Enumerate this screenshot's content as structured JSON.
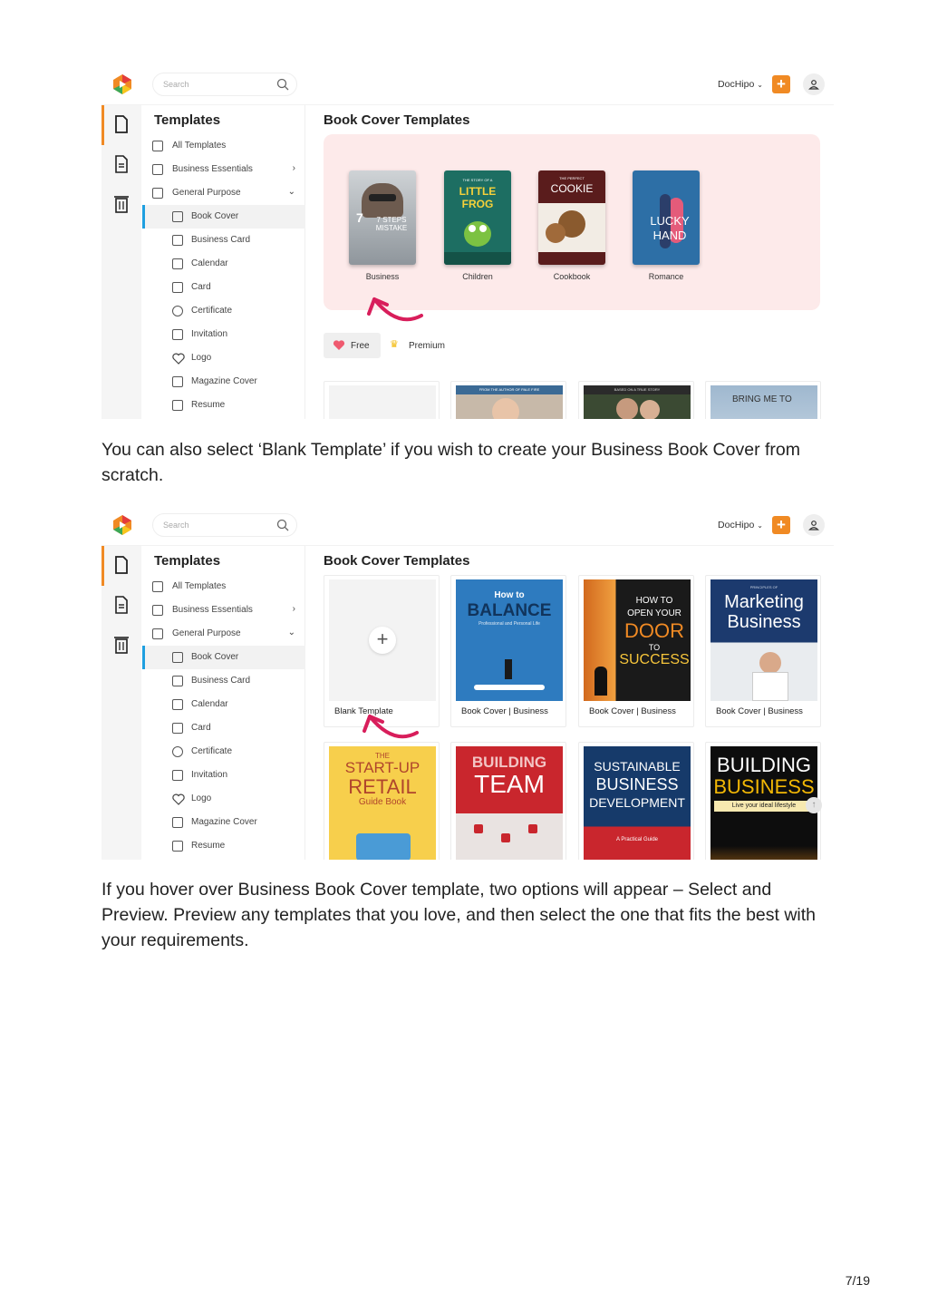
{
  "app": {
    "account": "DocHipo",
    "search_placeholder": "Search"
  },
  "sidebar": {
    "title": "Templates",
    "items": [
      {
        "label": "All Templates",
        "icon": "all-templates-icon"
      },
      {
        "label": "Business Essentials",
        "icon": "business-essentials-icon",
        "arrow": "›"
      },
      {
        "label": "General Purpose",
        "icon": "general-purpose-icon",
        "arrow": "⌄"
      },
      {
        "label": "Book Cover",
        "icon": "book-cover-icon"
      },
      {
        "label": "Business Card",
        "icon": "business-card-icon"
      },
      {
        "label": "Calendar",
        "icon": "calendar-icon"
      },
      {
        "label": "Card",
        "icon": "card-icon"
      },
      {
        "label": "Certificate",
        "icon": "certificate-icon"
      },
      {
        "label": "Invitation",
        "icon": "invitation-icon"
      },
      {
        "label": "Logo",
        "icon": "heart-icon"
      },
      {
        "label": "Magazine Cover",
        "icon": "magazine-cover-icon"
      },
      {
        "label": "Resume",
        "icon": "resume-icon"
      }
    ]
  },
  "main_title": "Book Cover Templates",
  "genres": [
    {
      "label": "Business",
      "cover_text": "7 STEPS MISTAKE"
    },
    {
      "label": "Children",
      "cover_text": "LITTLE FROG",
      "cover_pre": "THE STORY OF A"
    },
    {
      "label": "Cookbook",
      "cover_text": "COOKIE",
      "cover_pre": "THE PERFECT"
    },
    {
      "label": "Romance",
      "cover_text": "LUCKY HAND"
    }
  ],
  "filters": {
    "free": "Free",
    "premium": "Premium"
  },
  "screen2": {
    "templates": [
      {
        "caption": "Blank Template",
        "kind": "blank"
      },
      {
        "caption": "Book Cover | Business",
        "title_a": "How to",
        "title_b": "BALANCE",
        "sub": "Professional and Personal Life",
        "color": "#2e7bbf"
      },
      {
        "caption": "Book Cover | Business",
        "title_a": "HOW TO",
        "title_b": "OPEN YOUR",
        "title_c": "DOOR",
        "title_d": "TO",
        "title_e": "SUCCESS",
        "color": "#1a1a1a"
      },
      {
        "caption": "Book Cover | Business",
        "title_a": "PRINCIPLES OF",
        "title_b": "Marketing",
        "title_c": "Business",
        "color": "#1c3a6e"
      }
    ],
    "row2": [
      {
        "title_a": "THE",
        "title_b": "START-UP",
        "title_c": "RETAIL",
        "title_d": "Guide Book"
      },
      {
        "title_a": "BUILDING",
        "title_b": "TEAM"
      },
      {
        "title_a": "SUSTAINABLE",
        "title_b": "BUSINESS",
        "title_c": "DEVELOPMENT",
        "title_d": "A Practical Guide"
      },
      {
        "title_a": "BUILDING",
        "title_b": "BUSINESS",
        "title_c": "Live your ideal lifestyle"
      }
    ]
  },
  "screen1_row": [
    {
      "banner": ""
    },
    {
      "banner": "FROM THE AUTHOR OF PALE FIRE"
    },
    {
      "banner": "BASED ON A TRUE STORY"
    },
    {
      "banner": "BRING ME TO"
    }
  ],
  "paragraphs": {
    "p1": "You can also select ‘Blank Template’ if you wish to create your Business Book Cover from scratch.",
    "p2": "If you hover over Business Book Cover template, two options will appear – Select and Preview. Preview any templates that you love, and then select the one that fits the best with your requirements."
  },
  "page_number": "7/19",
  "colors": {
    "accent": "#f08a24",
    "active": "#1e9fe0",
    "genre_bg": "#fdeaea",
    "arrow": "#d81e5b"
  }
}
